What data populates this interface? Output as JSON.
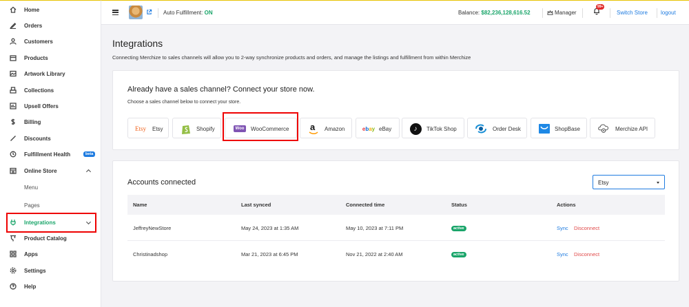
{
  "sidebar": {
    "items": [
      {
        "label": "Home",
        "icon": "home-icon"
      },
      {
        "label": "Orders",
        "icon": "orders-icon"
      },
      {
        "label": "Customers",
        "icon": "customers-icon"
      },
      {
        "label": "Products",
        "icon": "products-icon"
      },
      {
        "label": "Artwork Library",
        "icon": "image-icon"
      },
      {
        "label": "Collections",
        "icon": "collections-icon"
      },
      {
        "label": "Upsell Offers",
        "icon": "upsell-icon"
      },
      {
        "label": "Billing",
        "icon": "dollar-icon"
      },
      {
        "label": "Discounts",
        "icon": "tag-icon"
      },
      {
        "label": "Fulfillment Health",
        "icon": "health-icon",
        "badge": "beta"
      },
      {
        "label": "Online Store",
        "icon": "store-icon"
      },
      {
        "label": "Menu"
      },
      {
        "label": "Pages"
      },
      {
        "label": "Integrations",
        "icon": "integrations-icon"
      },
      {
        "label": "Product Catalog",
        "icon": "catalog-icon"
      },
      {
        "label": "Apps",
        "icon": "apps-icon"
      },
      {
        "label": "Settings",
        "icon": "gear-icon"
      },
      {
        "label": "Help",
        "icon": "help-icon"
      }
    ]
  },
  "topbar": {
    "auto_fulfillment_label": "Auto Fulfillment:",
    "auto_fulfillment_value": "ON",
    "balance_label": "Balance:",
    "balance_value": "$82,236,128,616.52",
    "manager_label": "Manager",
    "notifications_count": "99+",
    "switch_store": "Switch Store",
    "logout": "logout"
  },
  "page": {
    "title": "Integrations",
    "description": "Connecting Merchize to sales channels will allow you to 2-way synchronize products and orders, and manage the listings and fulfillment from within Merchize"
  },
  "connect": {
    "heading": "Already have a sales channel? Connect your store now.",
    "subheading": "Choose a sales channel below to connect your store.",
    "channels": [
      {
        "label": "Etsy",
        "icon": "etsy-logo"
      },
      {
        "label": "Shopify",
        "icon": "shopify-logo"
      },
      {
        "label": "WooCommerce",
        "icon": "woocommerce-logo"
      },
      {
        "label": "Amazon",
        "icon": "amazon-logo"
      },
      {
        "label": "eBay",
        "icon": "ebay-logo"
      },
      {
        "label": "TikTok Shop",
        "icon": "tiktok-logo"
      },
      {
        "label": "Order Desk",
        "icon": "order-desk-logo"
      },
      {
        "label": "ShopBase",
        "icon": "shopbase-logo"
      },
      {
        "label": "Merchize API",
        "icon": "merchize-api-logo"
      }
    ],
    "logo_text": {
      "etsy": "Etsy",
      "woo": "Woo",
      "ebay": "ebay"
    }
  },
  "accounts": {
    "heading": "Accounts connected",
    "filter_value": "Etsy",
    "columns": [
      "Name",
      "Last synced",
      "Connected time",
      "Status",
      "Actions"
    ],
    "rows": [
      {
        "name": "JeffreyNewStore",
        "last_synced": "May 24, 2023 at 1:35 AM",
        "connected": "May 10, 2023 at 7:11 PM",
        "status": "active",
        "sync": "Sync",
        "disconnect": "Disconnect"
      },
      {
        "name": "Christinadshop",
        "last_synced": "Mar 21, 2023 at 6:45 PM",
        "connected": "Nov 21, 2022 at 2:40 AM",
        "status": "active",
        "sync": "Sync",
        "disconnect": "Disconnect"
      }
    ]
  },
  "colors": {
    "accent": "#1aa56a",
    "link": "#1e7be0",
    "danger": "#e04848",
    "highlight": "#ee0000"
  }
}
